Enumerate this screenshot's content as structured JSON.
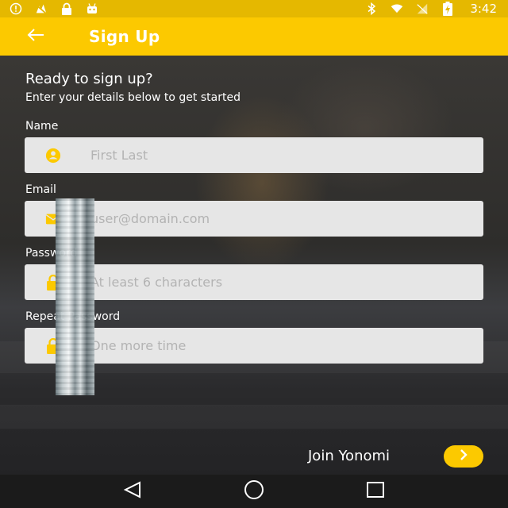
{
  "status_bar": {
    "time": "3:42",
    "left_icons": [
      "info-icon",
      "no-signal-icon",
      "lock-icon",
      "android-icon"
    ],
    "right_icons": [
      "bluetooth-icon",
      "wifi-icon",
      "no-sim-icon",
      "battery-charging-icon"
    ]
  },
  "app_bar": {
    "title": "Sign Up",
    "back_icon": "arrow-back-icon",
    "color": "#fcc900"
  },
  "form": {
    "heading": "Ready to sign up?",
    "subheading": "Enter your details below to get started",
    "fields": [
      {
        "label": "Name",
        "placeholder": "First Last",
        "value": "",
        "icon": "person-icon"
      },
      {
        "label": "Email",
        "placeholder": "user@domain.com",
        "value": "",
        "icon": "mail-icon"
      },
      {
        "label": "Password",
        "placeholder": "At least 6 characters",
        "value": "",
        "icon": "lock-icon"
      },
      {
        "label": "Repeat Password",
        "placeholder": "One more time",
        "value": "",
        "icon": "lock-icon"
      }
    ]
  },
  "join": {
    "label": "Join Yonomi",
    "icon": "chevron-right-icon"
  },
  "nav_bar": {
    "buttons": [
      "back-triangle-icon",
      "home-circle-icon",
      "recents-square-icon"
    ]
  }
}
